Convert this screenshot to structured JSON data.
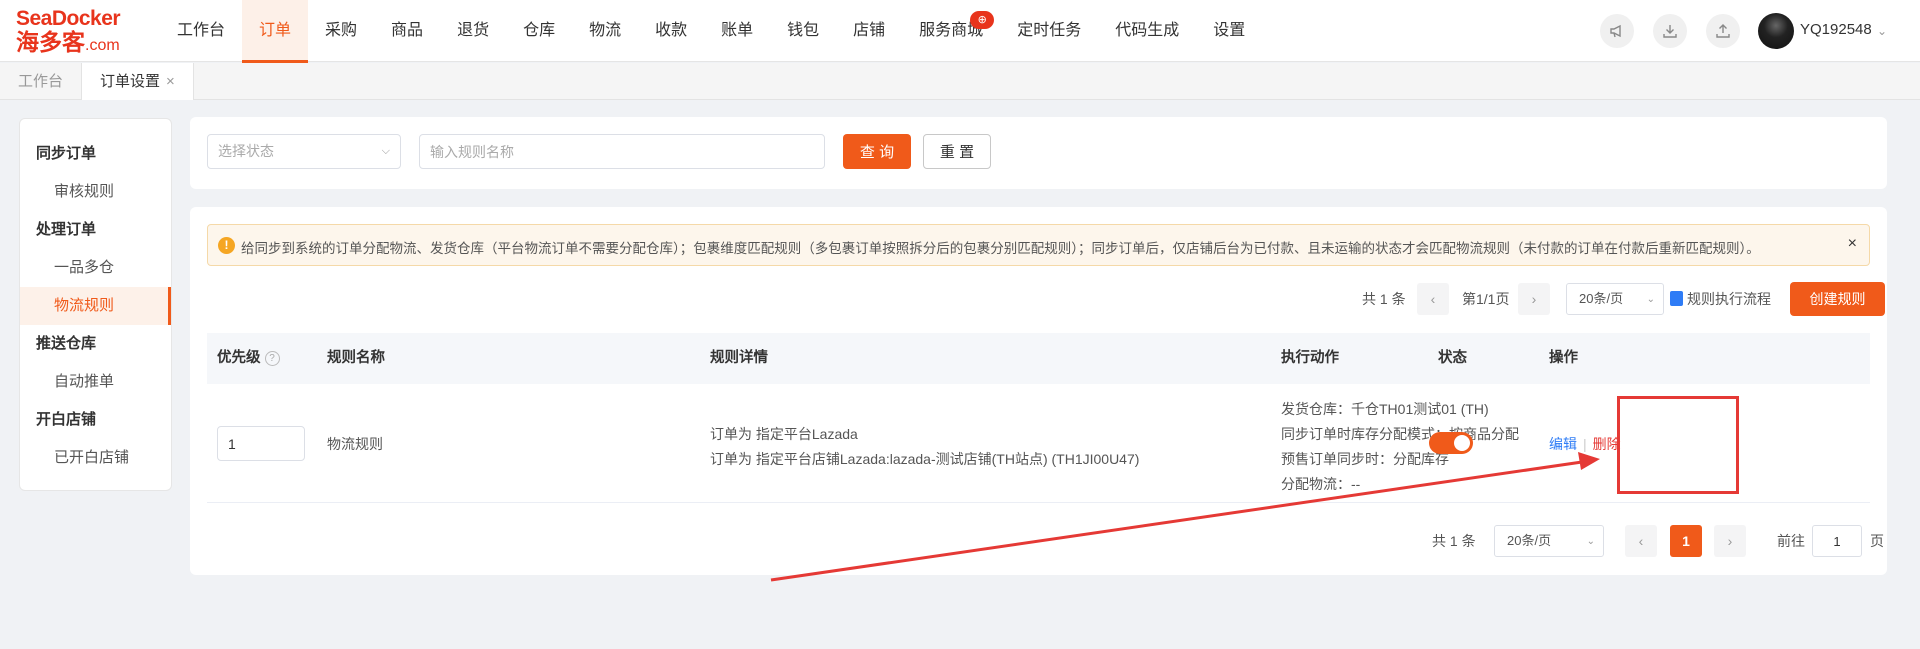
{
  "brand": {
    "logo_en": "SeaDocker",
    "logo_zh": "海多客",
    "logo_suffix": ".com",
    "accent": "#f05a1a"
  },
  "nav": {
    "items": [
      {
        "label": "工作台"
      },
      {
        "label": "订单",
        "active": true
      },
      {
        "label": "采购"
      },
      {
        "label": "商品"
      },
      {
        "label": "退货"
      },
      {
        "label": "仓库"
      },
      {
        "label": "物流"
      },
      {
        "label": "收款"
      },
      {
        "label": "账单"
      },
      {
        "label": "钱包"
      },
      {
        "label": "店铺"
      },
      {
        "label": "服务商城",
        "badge": "⊕"
      },
      {
        "label": "定时任务"
      },
      {
        "label": "代码生成"
      },
      {
        "label": "设置"
      }
    ],
    "service_badge": "⊕"
  },
  "user": {
    "name": "YQ192548"
  },
  "tabs": [
    {
      "label": "工作台"
    },
    {
      "label": "订单设置",
      "close": "×"
    }
  ],
  "sidebar": {
    "groups": [
      {
        "title": "同步订单",
        "items": [
          {
            "label": "审核规则"
          }
        ]
      },
      {
        "title": "处理订单",
        "items": [
          {
            "label": "一品多仓"
          },
          {
            "label": "物流规则",
            "active": true
          }
        ]
      },
      {
        "title": "推送仓库",
        "items": [
          {
            "label": "自动推单"
          }
        ]
      },
      {
        "title": "开白店铺",
        "items": [
          {
            "label": "已开白店铺"
          }
        ]
      }
    ]
  },
  "search": {
    "status_placeholder": "选择状态",
    "name_placeholder": "输入规则名称",
    "query_label": "查 询",
    "reset_label": "重 置"
  },
  "alert": {
    "icon": "!",
    "text": "给同步到系统的订单分配物流、发货仓库（平台物流订单不需要分配仓库）；包裹维度匹配规则（多包裹订单按照拆分后的包裹分别匹配规则）；同步订单后，仅店铺后台为已付款、且未运输的状态才会匹配物流规则（未付款的订单在付款后重新匹配规则）。",
    "close": "×"
  },
  "pager_top": {
    "total": "共 1 条",
    "page": "第1/1页",
    "page_size": "20条/页",
    "flow_link": "规则执行流程",
    "create_label": "创建规则"
  },
  "table": {
    "headers": {
      "priority": "优先级",
      "name": "规则名称",
      "detail": "规则详情",
      "action": "执行动作",
      "status": "状态",
      "ops": "操作"
    },
    "rows": [
      {
        "priority": "1",
        "name": "物流规则",
        "detail_1": "订单为 指定平台Lazada",
        "detail_2": "订单为 指定平台店铺Lazada:lazada-测试店铺(TH站点) (TH1JI00U47)",
        "action_1": "发货仓库：千仓TH01测试01 (TH)",
        "action_2": "同步订单时库存分配模式：按商品分配",
        "action_3": "预售订单同步时：分配库存",
        "action_4": "分配物流：--",
        "status_on": true,
        "edit": "编辑",
        "delete": "删除"
      }
    ]
  },
  "pager_bottom": {
    "total": "共 1 条",
    "page_size": "20条/页",
    "current": "1",
    "goto_label": "前往",
    "goto_value": "1",
    "page_unit": "页"
  }
}
